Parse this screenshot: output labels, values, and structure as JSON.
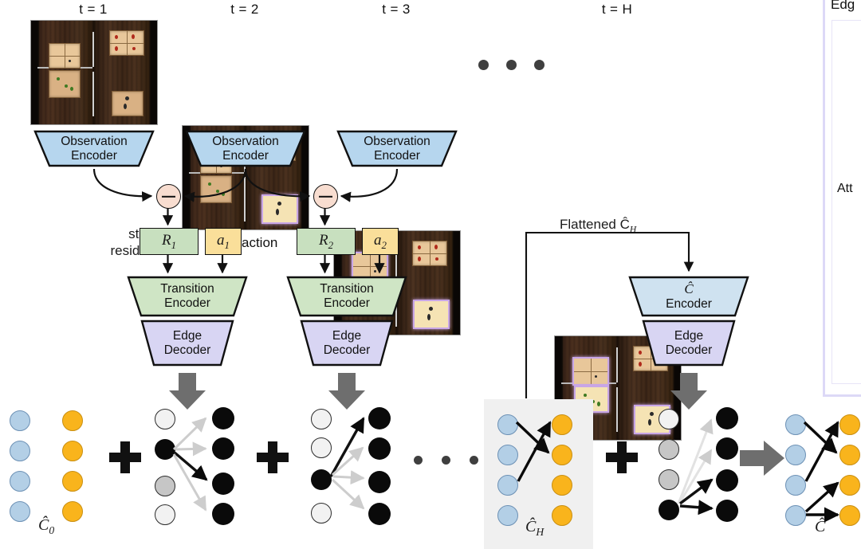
{
  "figure": {
    "timesteps": [
      {
        "label": "t = 1"
      },
      {
        "label": "t = 2"
      },
      {
        "label": "t = 3"
      },
      {
        "label": "t = H"
      }
    ],
    "encoders": {
      "observation": {
        "line1": "Observation",
        "line2": "Encoder"
      },
      "transition": {
        "line1": "Transition",
        "line2": "Encoder"
      },
      "edge_decoder": {
        "line1": "Edge",
        "line2": "Decoder"
      },
      "c_encoder": {
        "line1": "Ĉ",
        "line2": "Encoder"
      }
    },
    "labels": {
      "state_residual_line1": "state",
      "state_residual_line2": "residual",
      "action": "action",
      "flattened": "Flattened Ĉ",
      "flattened_sub": "H",
      "minus_symbol": "−",
      "plus_symbol": "+"
    },
    "tensors": [
      {
        "name": "R",
        "sub": "1",
        "kind": "state-residual"
      },
      {
        "name": "a",
        "sub": "1",
        "kind": "action"
      },
      {
        "name": "R",
        "sub": "2",
        "kind": "state-residual"
      },
      {
        "name": "a",
        "sub": "2",
        "kind": "action"
      }
    ],
    "graphs": [
      {
        "id": "c0",
        "label": "Ĉ",
        "sub": "0",
        "type": "bipartite-node-only",
        "left_nodes": 4,
        "right_nodes": 4,
        "left_color": "blue",
        "right_color": "orange"
      },
      {
        "id": "e1",
        "label": "",
        "sub": "",
        "type": "edge-prediction",
        "left_nodes": 4,
        "right_nodes": 4
      },
      {
        "id": "e2",
        "label": "",
        "sub": "",
        "type": "edge-prediction",
        "left_nodes": 4,
        "right_nodes": 4
      },
      {
        "id": "cH",
        "label": "Ĉ",
        "sub": "H",
        "type": "bipartite-edges",
        "left_nodes": 4,
        "right_nodes": 4,
        "left_color": "blue",
        "right_color": "orange",
        "highlighted": true
      },
      {
        "id": "eH",
        "label": "",
        "sub": "",
        "type": "edge-prediction",
        "left_nodes": 4,
        "right_nodes": 4
      },
      {
        "id": "cfin",
        "label": "Ĉ",
        "sub": "",
        "type": "bipartite-edges",
        "left_nodes": 4,
        "right_nodes": 4,
        "left_color": "blue",
        "right_color": "orange"
      }
    ],
    "side_panel": {
      "header_partial": "Edg",
      "body_partial": "Att"
    },
    "colors": {
      "observation_encoder": "#b6d6ee",
      "transition_encoder": "#cfe5c5",
      "edge_decoder": "#d8d5f3",
      "c_encoder": "#cfe2f0",
      "residual_box": "#c8e0bf",
      "action_box": "#fadf9a",
      "minus_node": "#f8ddd0",
      "node_blue": "#b3cfe6",
      "node_orange": "#f9b41c",
      "gray_arrow": "#6e6e6e",
      "highlight_panel": "#f0f0f0",
      "side_panel_border": "#ddd9f7"
    }
  }
}
